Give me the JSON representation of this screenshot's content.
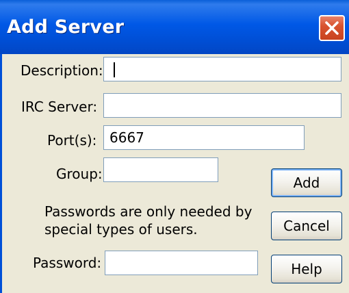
{
  "window": {
    "title": "Add Server",
    "close_icon": "close-icon"
  },
  "form": {
    "description": {
      "label": "Description:",
      "value": ""
    },
    "irc_server": {
      "label": "IRC Server:",
      "value": ""
    },
    "ports": {
      "label": "Port(s):",
      "value": "6667"
    },
    "group": {
      "label": "Group:",
      "value": ""
    },
    "note_line1": "Passwords are only needed by",
    "note_line2": "special types of users.",
    "password": {
      "label": "Password:",
      "value": ""
    }
  },
  "buttons": {
    "add": "Add",
    "cancel": "Cancel",
    "help": "Help"
  },
  "colors": {
    "titlebar": "#0054e3",
    "close": "#d9532f",
    "dialog_bg": "#ece9d8"
  }
}
